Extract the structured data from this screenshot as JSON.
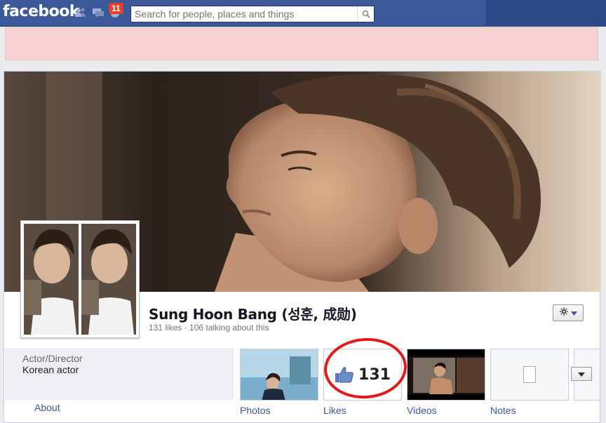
{
  "topbar": {
    "logo": "facebook",
    "notifications_count": "11",
    "search_placeholder": "Search for people, places and things",
    "icons": [
      "friend-requests-icon",
      "messages-icon",
      "notifications-icon",
      "search-icon"
    ]
  },
  "profile": {
    "name": "Sung Hoon Bang (성훈, 成勋)",
    "stats": "131 likes · 106 talking about this",
    "category": "Actor/Director",
    "description": "Korean actor",
    "about_label": "About"
  },
  "tiles": [
    {
      "label": "Photos"
    },
    {
      "label": "Likes",
      "count": "131"
    },
    {
      "label": "Videos"
    },
    {
      "label": "Notes"
    }
  ],
  "colors": {
    "brand_blue": "#3b5998",
    "banner_pink": "#f8d2d2",
    "annotation_red": "#e01b1b",
    "badge_red": "#f03d25"
  }
}
